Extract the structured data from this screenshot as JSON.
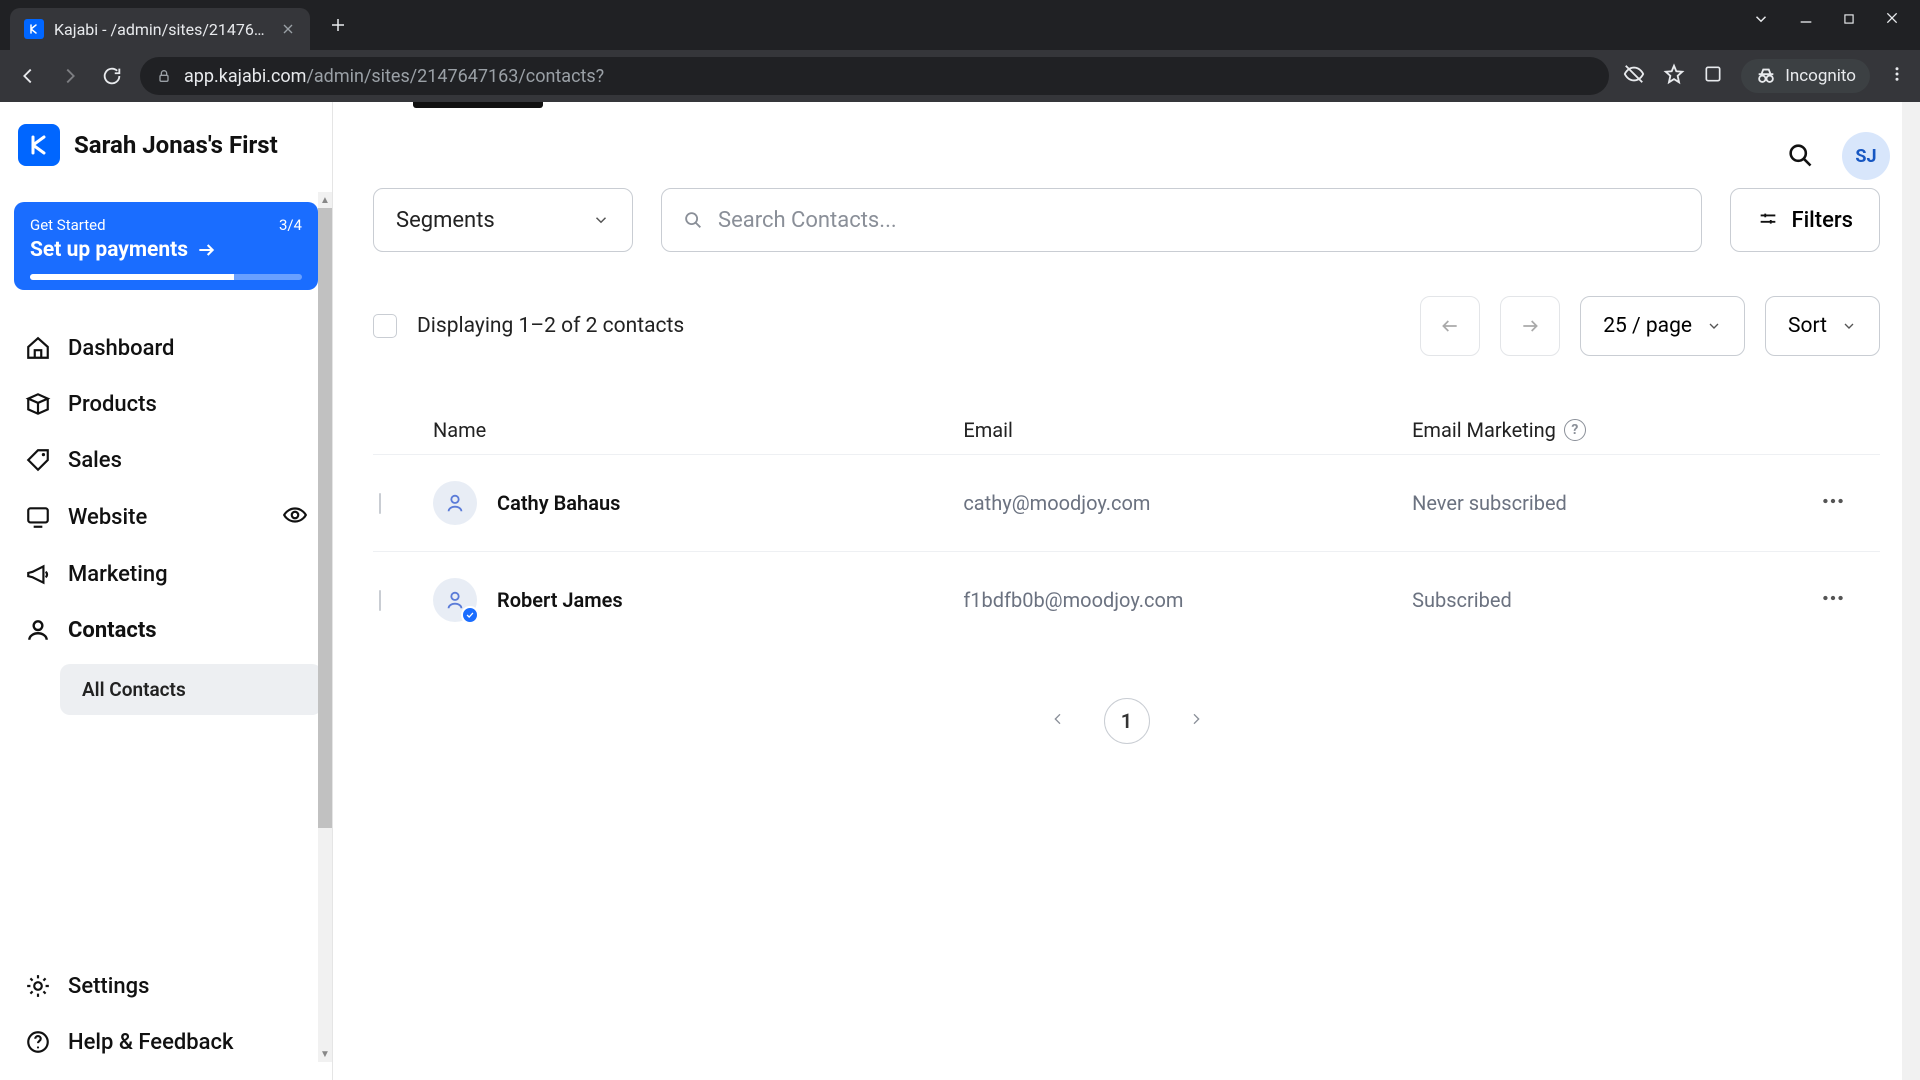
{
  "browser": {
    "tab_title": "Kajabi - /admin/sites/2147647163",
    "url_prefix": "app.kajabi.com",
    "url_suffix": "/admin/sites/2147647163/contacts?",
    "incognito_label": "Incognito"
  },
  "header": {
    "site_name": "Sarah Jonas's First",
    "avatar_initials": "SJ"
  },
  "get_started": {
    "eyebrow": "Get Started",
    "progress_text": "3/4",
    "cta": "Set up payments"
  },
  "nav": {
    "dashboard": "Dashboard",
    "products": "Products",
    "sales": "Sales",
    "website": "Website",
    "marketing": "Marketing",
    "contacts": "Contacts",
    "all_contacts": "All Contacts",
    "settings": "Settings",
    "help": "Help & Feedback"
  },
  "toolbar": {
    "segments_label": "Segments",
    "search_placeholder": "Search Contacts...",
    "filters_label": "Filters"
  },
  "list": {
    "displaying": "Displaying 1–2 of 2 contacts",
    "per_page": "25 / page",
    "sort_label": "Sort",
    "columns": {
      "name": "Name",
      "email": "Email",
      "marketing": "Email Marketing"
    },
    "rows": [
      {
        "name": "Cathy Bahaus",
        "email": "cathy@moodjoy.com",
        "marketing": "Never subscribed",
        "verified": false
      },
      {
        "name": "Robert James",
        "email": "f1bdfb0b@moodjoy.com",
        "marketing": "Subscribed",
        "verified": true
      }
    ],
    "page_number": "1"
  }
}
